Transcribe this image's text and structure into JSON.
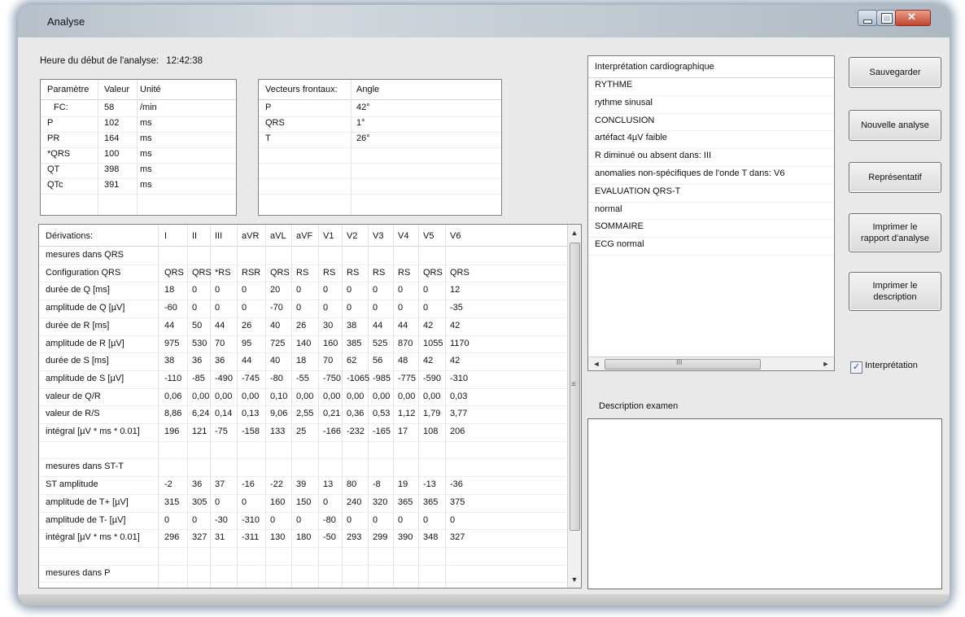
{
  "window": {
    "title": "Analyse"
  },
  "start": {
    "label": "Heure du début de l'analyse:",
    "time": "12:42:38"
  },
  "params": {
    "headers": [
      "Paramètre",
      "Valeur",
      "Unité"
    ],
    "rows": [
      [
        "FC:",
        "58",
        "/min"
      ],
      [
        "P",
        "102",
        "ms"
      ],
      [
        "PR",
        "164",
        "ms"
      ],
      [
        "*QRS",
        "100",
        "ms"
      ],
      [
        "QT",
        "398",
        "ms"
      ],
      [
        "QTc",
        "391",
        "ms"
      ]
    ]
  },
  "vectors": {
    "headers": [
      "Vecteurs frontaux:",
      "Angle"
    ],
    "rows": [
      [
        "P",
        "42°"
      ],
      [
        "QRS",
        "1°"
      ],
      [
        "T",
        "26°"
      ]
    ]
  },
  "derivations": {
    "headers": [
      "Dérivations:",
      "I",
      "II",
      "III",
      "aVR",
      "aVL",
      "aVF",
      "V1",
      "V2",
      "V3",
      "V4",
      "V5",
      "V6"
    ],
    "rows": [
      [
        "mesures dans QRS",
        "",
        "",
        "",
        "",
        "",
        "",
        "",
        "",
        "",
        "",
        "",
        ""
      ],
      [
        "Configuration QRS",
        "QRS",
        "QRS",
        "*RS",
        "RSR",
        "QRS",
        "RS",
        "RS",
        "RS",
        "RS",
        "RS",
        "QRS",
        "QRS"
      ],
      [
        "durée de Q [ms]",
        "18",
        "0",
        "0",
        "0",
        "20",
        "0",
        "0",
        "0",
        "0",
        "0",
        "0",
        "12"
      ],
      [
        "amplitude de Q [µV]",
        "-60",
        "0",
        "0",
        "0",
        "-70",
        "0",
        "0",
        "0",
        "0",
        "0",
        "0",
        "-35"
      ],
      [
        "durée de R [ms]",
        "44",
        "50",
        "44",
        "26",
        "40",
        "26",
        "30",
        "38",
        "44",
        "44",
        "42",
        "42"
      ],
      [
        "amplitude de R [µV]",
        "975",
        "530",
        "70",
        "95",
        "725",
        "140",
        "160",
        "385",
        "525",
        "870",
        "1055",
        "1170"
      ],
      [
        "durée de S [ms]",
        "38",
        "36",
        "36",
        "44",
        "40",
        "18",
        "70",
        "62",
        "56",
        "48",
        "42",
        "42"
      ],
      [
        "amplitude de S [µV]",
        "-110",
        "-85",
        "-490",
        "-745",
        "-80",
        "-55",
        "-750",
        "-1065",
        "-985",
        "-775",
        "-590",
        "-310"
      ],
      [
        "valeur de Q/R",
        "0,06",
        "0,00",
        "0,00",
        "0,00",
        "0,10",
        "0,00",
        "0,00",
        "0,00",
        "0,00",
        "0,00",
        "0,00",
        "0,03"
      ],
      [
        "valeur de R/S",
        "8,86",
        "6,24",
        "0,14",
        "0,13",
        "9,06",
        "2,55",
        "0,21",
        "0,36",
        "0,53",
        "1,12",
        "1,79",
        "3,77"
      ],
      [
        "intégral [µV * ms * 0.01]",
        "196",
        "121",
        "-75",
        "-158",
        "133",
        "25",
        "-166",
        "-232",
        "-165",
        "17",
        "108",
        "206"
      ],
      [
        "",
        "",
        "",
        "",
        "",
        "",
        "",
        "",
        "",
        "",
        "",
        "",
        ""
      ],
      [
        "mesures dans ST-T",
        "",
        "",
        "",
        "",
        "",
        "",
        "",
        "",
        "",
        "",
        "",
        ""
      ],
      [
        "ST amplitude",
        "-2",
        "36",
        "37",
        "-16",
        "-22",
        "39",
        "13",
        "80",
        "-8",
        "19",
        "-13",
        "-36"
      ],
      [
        "amplitude de T+ [µV]",
        "315",
        "305",
        "0",
        "0",
        "160",
        "150",
        "0",
        "240",
        "320",
        "365",
        "365",
        "375"
      ],
      [
        "amplitude de T- [µV]",
        "0",
        "0",
        "-30",
        "-310",
        "0",
        "0",
        "-80",
        "0",
        "0",
        "0",
        "0",
        "0"
      ],
      [
        "intégral [µV * ms * 0.01]",
        "296",
        "327",
        "31",
        "-311",
        "130",
        "180",
        "-50",
        "293",
        "299",
        "390",
        "348",
        "327"
      ],
      [
        "",
        "",
        "",
        "",
        "",
        "",
        "",
        "",
        "",
        "",
        "",
        "",
        ""
      ],
      [
        "mesures dans P",
        "",
        "",
        "",
        "",
        "",
        "",
        "",
        "",
        "",
        "",
        "",
        ""
      ]
    ]
  },
  "interpretation": {
    "header": "Interprétation cardiographique",
    "lines": [
      "RYTHME",
      "rythme sinusal",
      "CONCLUSION",
      "artéfact 4µV faible",
      "R diminué ou absent dans: III",
      "anomalies non-spécifiques de l'onde T dans: V6",
      "EVALUATION QRS-T",
      "normal",
      "SOMMAIRE",
      "ECG normal"
    ]
  },
  "buttons": {
    "save": "Sauvegarder",
    "new_analysis": "Nouvelle analyse",
    "representative": "Représentatif",
    "print_report": "Imprimer le\nrapport d'analyse",
    "print_description": "Imprimer le\ndescription"
  },
  "checkbox": {
    "label": "Interprétation",
    "checked": true,
    "mark": "✓"
  },
  "description": {
    "label": "Description examen",
    "value": ""
  },
  "scroll": {
    "up": "▲",
    "down": "▼",
    "left": "◄",
    "right": "►",
    "grip": "≡",
    "hgrip": "III"
  },
  "colors": {
    "window_bg": "#e9e9e9",
    "panel_bg": "#ffffff",
    "border": "#808080",
    "glow": "#8fa0b4"
  }
}
